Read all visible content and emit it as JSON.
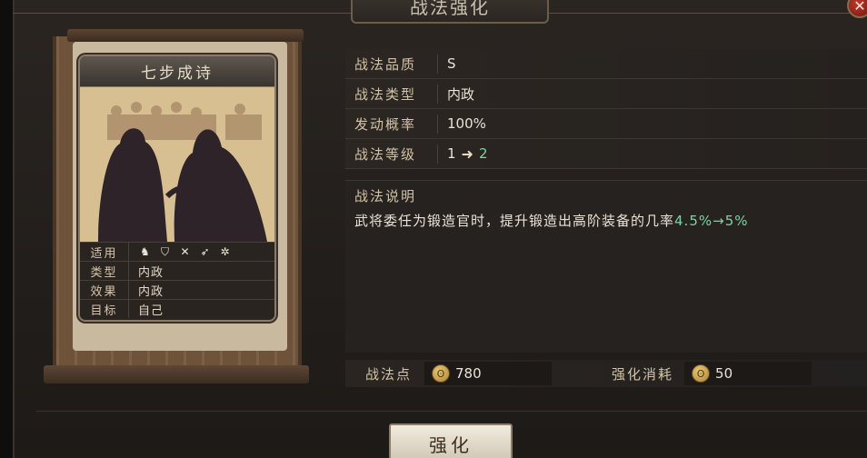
{
  "window": {
    "title": "战法强化",
    "close_glyph": "✕"
  },
  "card": {
    "name": "七步成诗",
    "rows": [
      {
        "key": "适用",
        "value": "",
        "icons": [
          "cavalry-icon",
          "shield-icon",
          "bow-icon",
          "spear-icon",
          "wheel-icon"
        ]
      },
      {
        "key": "类型",
        "value": "内政"
      },
      {
        "key": "效果",
        "value": "内政"
      },
      {
        "key": "目标",
        "value": "自己"
      }
    ]
  },
  "info": {
    "quality": {
      "label": "战法品质",
      "value": "S"
    },
    "type": {
      "label": "战法类型",
      "value": "内政"
    },
    "chance": {
      "label": "发动概率",
      "value": "100%"
    },
    "level": {
      "label": "战法等级",
      "from": "1",
      "to": "2"
    }
  },
  "description": {
    "label": "战法说明",
    "text": "武将委任为锻造官时，提升锻造出高阶装备的几率",
    "change": "4.5%→5%"
  },
  "cost": {
    "points_label": "战法点",
    "points_value": "780",
    "consume_label": "强化消耗",
    "consume_value": "50"
  },
  "action": {
    "label": "强化"
  },
  "colors": {
    "accent_green": "#7dd3a1",
    "coin_gold": "#c9a24a"
  }
}
